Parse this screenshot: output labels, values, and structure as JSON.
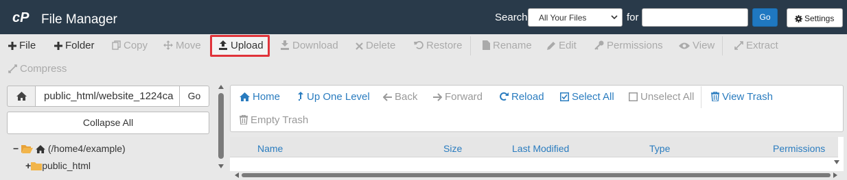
{
  "header": {
    "title": "File Manager",
    "search_label": "Search",
    "search_scope": "All Your Files",
    "for_label": "for",
    "search_placeholder": "",
    "go_label": "Go",
    "settings_label": "Settings"
  },
  "toolbar": {
    "file": "File",
    "folder": "Folder",
    "copy": "Copy",
    "move": "Move",
    "upload": "Upload",
    "download": "Download",
    "delete": "Delete",
    "restore": "Restore",
    "rename": "Rename",
    "edit": "Edit",
    "permissions": "Permissions",
    "view": "View",
    "extract": "Extract",
    "compress": "Compress"
  },
  "left_panel": {
    "path_value": "public_html/website_1224ca",
    "go_label": "Go",
    "collapse_all_label": "Collapse All",
    "tree": [
      {
        "label": "(/home4/example)",
        "expander": "−"
      },
      {
        "label": "public_html",
        "expander": "+"
      }
    ]
  },
  "actions": {
    "home": "Home",
    "up_one_level": "Up One Level",
    "back": "Back",
    "forward": "Forward",
    "reload": "Reload",
    "select_all": "Select All",
    "unselect_all": "Unselect All",
    "view_trash": "View Trash",
    "empty_trash": "Empty Trash"
  },
  "table": {
    "columns": [
      "Name",
      "Size",
      "Last Modified",
      "Type",
      "Permissions"
    ]
  },
  "colors": {
    "header_bg": "#293a4a",
    "link_blue": "#2a7cbf",
    "highlight_red": "#e0333a",
    "go_blue": "#1f78c1"
  }
}
